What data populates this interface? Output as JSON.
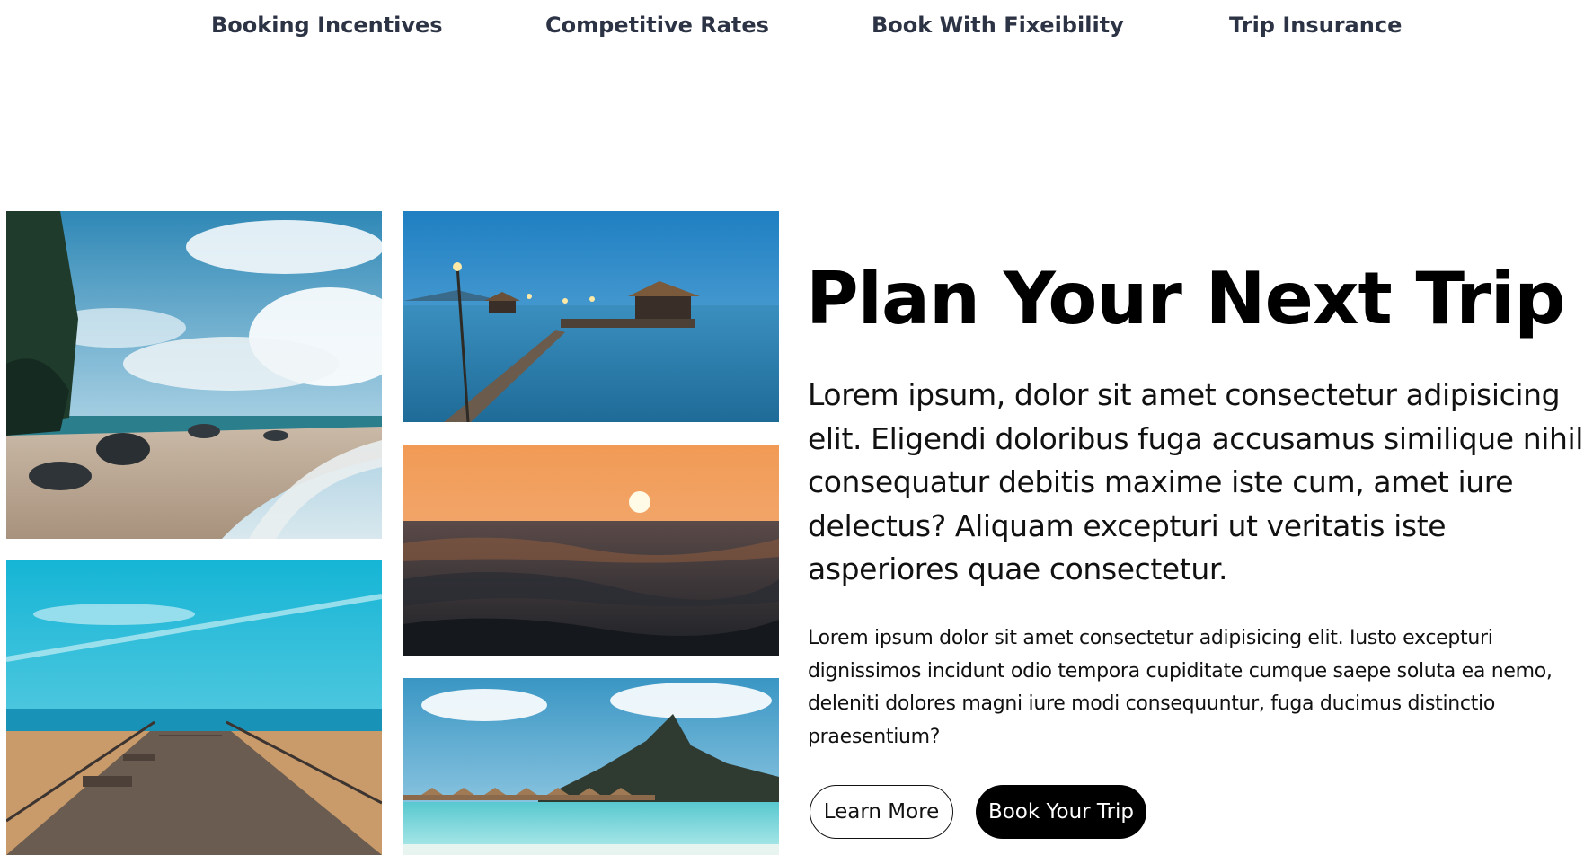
{
  "nav": {
    "items": [
      {
        "label": "Booking Incentives"
      },
      {
        "label": "Competitive Rates"
      },
      {
        "label": "Book With Fixeibility"
      },
      {
        "label": "Trip Insurance"
      }
    ]
  },
  "hero": {
    "title": "Plan Your Next Trip",
    "lead": "Lorem ipsum, dolor sit amet consectetur adipisicing elit. Eligendi doloribus fuga accusamus similique nihil consequatur debitis maxime iste cum, amet iure delectus? Aliquam excepturi ut veritatis iste asperiores quae consectetur.",
    "body": "Lorem ipsum dolor sit amet consectetur adipisicing elit. Iusto excepturi dignissimos incidunt odio tempora cupiditate cumque saepe soluta ea nemo, deleniti dolores magni iure modi consequuntur, fuga ducimus distinctio praesentium?",
    "learn_more_label": "Learn More",
    "book_trip_label": "Book Your Trip"
  },
  "colors": {
    "nav_text": "#2c3345",
    "primary_button_bg": "#000000",
    "primary_button_text": "#ffffff"
  }
}
